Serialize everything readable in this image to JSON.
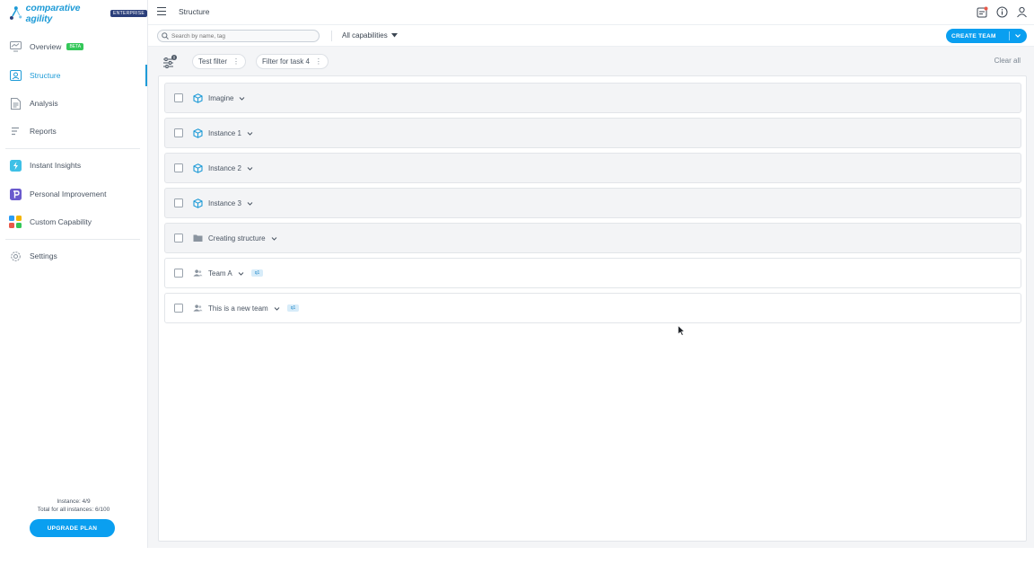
{
  "app": {
    "logo_text": "comparative agility",
    "edition": "ENTERPRISE",
    "page_title": "Structure"
  },
  "sidebar": {
    "items": [
      {
        "label": "Overview",
        "badge": "BETA",
        "icon": "monitor-icon"
      },
      {
        "label": "Structure",
        "icon": "structure-icon",
        "active": true
      },
      {
        "label": "Analysis",
        "icon": "document-icon"
      },
      {
        "label": "Reports",
        "icon": "list-icon"
      },
      {
        "label": "Instant Insights",
        "icon": "lightning-icon"
      },
      {
        "label": "Personal Improvement",
        "icon": "personal-improvement-icon"
      },
      {
        "label": "Custom Capability",
        "icon": "grid-icon"
      },
      {
        "label": "Settings",
        "icon": "gear-icon"
      }
    ],
    "instance_info": "Instance: 4/9",
    "total_info": "Total for all instances: 6/100",
    "upgrade_label": "UPGRADE PLAN"
  },
  "toolbar": {
    "search_placeholder": "Search by name, tag",
    "capabilities_label": "All capabilities",
    "create_team_label": "CREATE TEAM"
  },
  "filters": {
    "chips": [
      "Test filter",
      "Filter for task 4"
    ],
    "clear_all": "Clear all",
    "settings_badge": "0"
  },
  "structure": {
    "rows": [
      {
        "label": "Imagine",
        "type": "instance"
      },
      {
        "label": "Instance 1",
        "type": "instance"
      },
      {
        "label": "Instance 2",
        "type": "instance"
      },
      {
        "label": "Instance 3",
        "type": "instance"
      },
      {
        "label": "Creating structure",
        "type": "folder"
      },
      {
        "label": "Team A",
        "type": "team",
        "tag": "q1"
      },
      {
        "label": "This is a new team",
        "type": "team",
        "tag": "q1"
      }
    ]
  },
  "colors": {
    "accent": "#0a9ff0",
    "brand": "#1e9bd7",
    "beta": "#34c759"
  }
}
